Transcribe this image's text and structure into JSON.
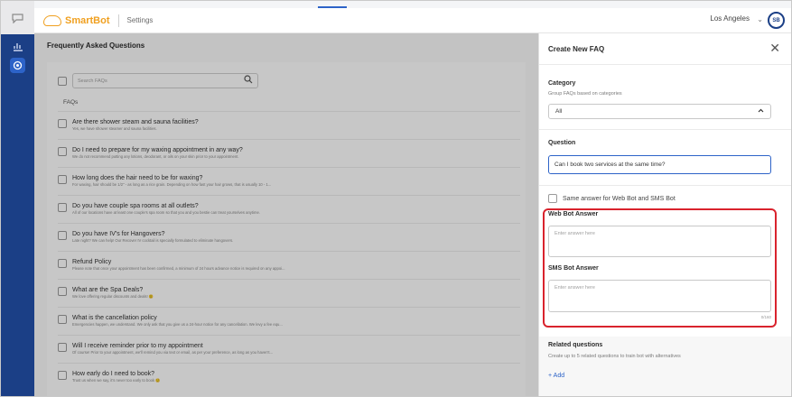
{
  "topbar": {
    "brand": "SmartBot",
    "section": "Settings",
    "location": "Los Angeles",
    "avatar_initials": "SB"
  },
  "main": {
    "title": "Frequently Asked Questions",
    "search_placeholder": "Search FAQs",
    "list_label": "FAQs",
    "faqs": [
      {
        "q": "Are there shower steam and sauna facilities?",
        "a": "Yes, we have shower steamer and sauna facilities."
      },
      {
        "q": "Do I need to prepare for my waxing appointment in any way?",
        "a": "We do not recommend putting any lotions, deodorant, or oils on your skin prior to your appointment."
      },
      {
        "q": "How long does the hair need to be for waxing?",
        "a": "For waxing, hair should be 1/2\" - as long as a rice grain. Depending on how fast your hair grows, that is usually 10 - 1..."
      },
      {
        "q": "Do you have couple spa rooms at all outlets?",
        "a": "All of our locations have at least one couple's spa room so that you and you bestie can treat yourselves anytime."
      },
      {
        "q": "Do you have IV's for Hangovers?",
        "a": "Late night? We can help! Our Recover IV cocktail is specially formulated to eliminate hangovers."
      },
      {
        "q": "Refund Policy",
        "a": "Please note that once your appointment has been confirmed, a minimum of 24 hours advance notice is required on any appoi..."
      },
      {
        "q": "What are the Spa Deals?",
        "a": "We love offering regular discounts and deals! 🙂"
      },
      {
        "q": "What is the cancellation policy",
        "a": "Emergencies happen, we understand. We only ask that you give us a 24-hour notice for any cancellation. We levy a fee equ..."
      },
      {
        "q": "Will I receive reminder prior to my appointment",
        "a": "Of course! Prior to your appointment, we'll remind you via text or email, as per your preference, as long as you haven't..."
      },
      {
        "q": "How early do I need to book?",
        "a": "Trust us when we say, it's never too early to book 🙂"
      }
    ]
  },
  "panel": {
    "title": "Create New FAQ",
    "category_label": "Category",
    "category_sub": "Group FAQs based on categories",
    "category_value": "All",
    "question_label": "Question",
    "question_value": "Can I book two services at the same time?",
    "same_answer_label": "Same answer for Web Bot and SMS Bot",
    "web_label": "Web Bot Answer",
    "web_placeholder": "Enter answer here",
    "sms_label": "SMS Bot Answer",
    "sms_placeholder": "Enter answer here",
    "sms_counter": "0/160",
    "related_label": "Related questions",
    "related_sub": "Create up to 5 related questions to train bot with alternatives",
    "add_label": "+ Add"
  },
  "colors": {
    "rail": "#1b3f86",
    "accent": "#2d63c8",
    "brand": "#f0a020",
    "highlight": "#d9232d"
  }
}
